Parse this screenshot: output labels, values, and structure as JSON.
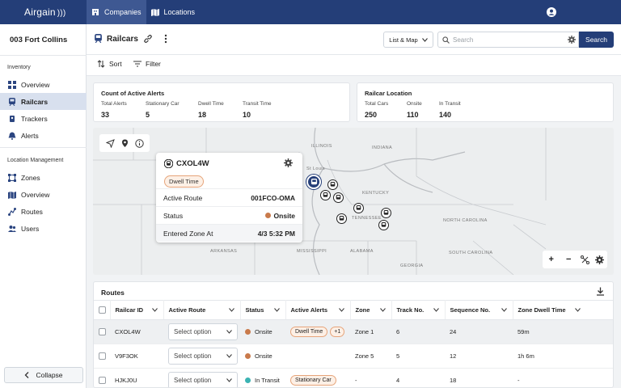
{
  "app": {
    "logo": "Airgain",
    "logo_waves": ")))"
  },
  "topnav": {
    "tabs": [
      {
        "label": "Companies",
        "active": true
      },
      {
        "label": "Locations",
        "active": false
      }
    ]
  },
  "sidebar": {
    "title": "003 Fort Collins",
    "sections": [
      {
        "label": "Inventory",
        "items": [
          {
            "label": "Overview",
            "icon": "grid-icon"
          },
          {
            "label": "Railcars",
            "icon": "train-icon",
            "active": true
          },
          {
            "label": "Trackers",
            "icon": "tracker-icon"
          },
          {
            "label": "Alerts",
            "icon": "bell-icon"
          }
        ]
      },
      {
        "label": "Location Management",
        "items": [
          {
            "label": "Zones",
            "icon": "zones-icon"
          },
          {
            "label": "Overview",
            "icon": "map-icon"
          },
          {
            "label": "Routes",
            "icon": "route-icon"
          },
          {
            "label": "Users",
            "icon": "users-icon"
          }
        ]
      }
    ],
    "collapse_label": "Collapse"
  },
  "header": {
    "title": "Railcars",
    "view_select": "List & Map",
    "search_placeholder": "Search",
    "search_button": "Search"
  },
  "toolbar": {
    "sort": "Sort",
    "filter": "Filter"
  },
  "alerts_card": {
    "title": "Count of Active Alerts",
    "stats": [
      {
        "label": "Total Alerts",
        "value": "33"
      },
      {
        "label": "Stationary Car",
        "value": "5"
      },
      {
        "label": "Dwell Time",
        "value": "18"
      },
      {
        "label": "Transit Time",
        "value": "10"
      }
    ]
  },
  "location_card": {
    "title": "Railcar Location",
    "stats": [
      {
        "label": "Total Cars",
        "value": "250"
      },
      {
        "label": "Onsite",
        "value": "110"
      },
      {
        "label": "In Transit",
        "value": "140"
      }
    ]
  },
  "map": {
    "labels": [
      "ILLINOIS",
      "INDIANA",
      "KENTUCKY",
      "TENNESSEE",
      "NORTH CAROLINA",
      "SOUTH CAROLINA",
      "MISSISSIPPI",
      "ALABAMA",
      "GEORGIA",
      "ARKANSAS",
      "St Louis"
    ],
    "popup": {
      "id": "CXOL4W",
      "badge": "Dwell Time",
      "rows": [
        {
          "label": "Active Route",
          "value": "001FCO-OMA"
        },
        {
          "label": "Status",
          "value": "Onsite",
          "status_color": "#c97a4b"
        },
        {
          "label": "Entered Zone At",
          "value": "4/3 5:32 PM"
        }
      ]
    },
    "zoom_in": "+",
    "zoom_out": "−"
  },
  "routes": {
    "title": "Routes",
    "columns": [
      "Railcar ID",
      "Active Route",
      "Status",
      "Active Alerts",
      "Zone",
      "Track No.",
      "Sequence No.",
      "Zone Dwell Time"
    ],
    "rows": [
      {
        "id": "CXOL4W",
        "route": "Select option",
        "status": "Onsite",
        "status_color": "#c97a4b",
        "alert": "Dwell Time",
        "alert_extra": "+1",
        "zone": "Zone 1",
        "track": "6",
        "seq": "24",
        "dwell": "59m",
        "selected": true
      },
      {
        "id": "V9F3OK",
        "route": "Select option",
        "status": "Onsite",
        "status_color": "#c97a4b",
        "alert": "",
        "alert_extra": "",
        "zone": "Zone 5",
        "track": "5",
        "seq": "12",
        "dwell": "1h 6m",
        "selected": false
      },
      {
        "id": "HJKJ0U",
        "route": "Select option",
        "status": "In Transit",
        "status_color": "#3bb3b3",
        "alert": "Stationary Car",
        "alert_extra": "",
        "zone": "-",
        "track": "4",
        "seq": "18",
        "dwell": "-",
        "selected": false
      }
    ]
  }
}
